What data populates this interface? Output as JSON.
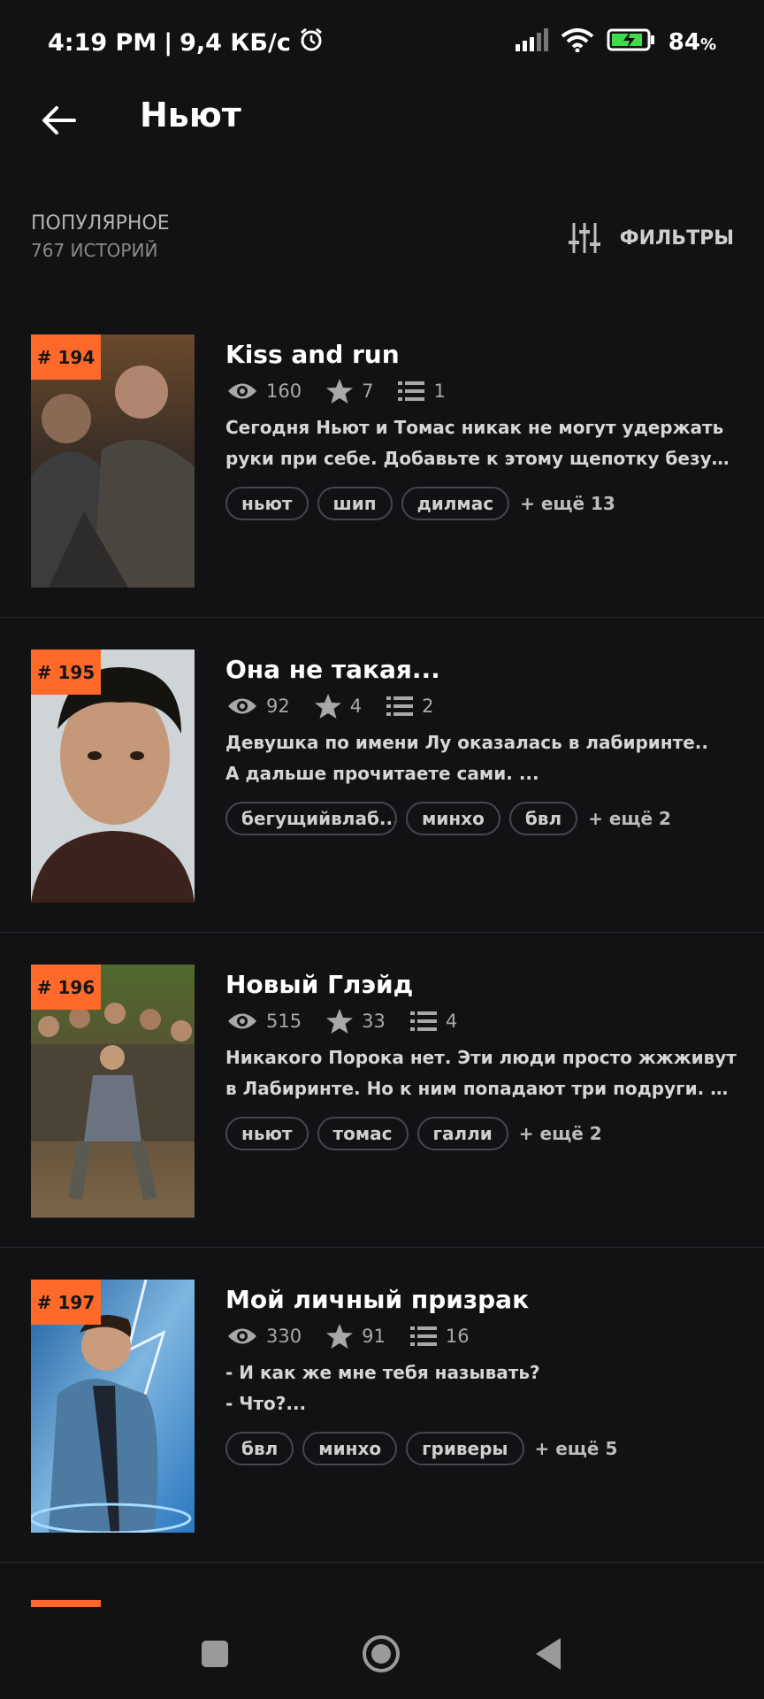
{
  "status_bar": {
    "time": "4:19 PM",
    "speed": "9,4 КБ/с",
    "battery_percent": "84",
    "battery_unit": "%",
    "icons": [
      "alarm-icon",
      "signal-icon",
      "wifi-icon",
      "battery-charging-icon"
    ]
  },
  "app_bar": {
    "back_icon": "arrow-left-icon",
    "title": "Ньют"
  },
  "section": {
    "sort_label": "ПОПУЛЯРНОЕ",
    "count_label": "767 ИСТОРИЙ",
    "filters_label": "ФИЛЬТРЫ",
    "filters_icon": "sliders-icon"
  },
  "stories": [
    {
      "rank": "# 194",
      "title": "Kiss and run",
      "views": "160",
      "stars": "7",
      "chapters": "1",
      "desc_line1": "Сегодня Ньют и Томас никак не могут удержать",
      "desc_line2": "руки при себе. Добавьте к этому щепотку безумия и ...",
      "tags": [
        "ньют",
        "шип",
        "дилмас"
      ],
      "more_tags": "+ ещё 13"
    },
    {
      "rank": "# 195",
      "title": "Она не такая...",
      "views": "92",
      "stars": "4",
      "chapters": "2",
      "desc_line1": "Девушка по имени Лу оказалась в лабиринте..",
      "desc_line2": "А дальше прочитаете сами. ...",
      "tags": [
        "бегущийвлаб...",
        "минхо",
        "бвл"
      ],
      "more_tags": "+ ещё 2"
    },
    {
      "rank": "# 196",
      "title": "Новый Глэйд",
      "views": "515",
      "stars": "33",
      "chapters": "4",
      "desc_line1": "Никакого Порока нет. Эти люди просто жжживут",
      "desc_line2": "в Лабиринте. Но к ним попадают три подруги. Как из...",
      "tags": [
        "ньют",
        "томас",
        "галли"
      ],
      "more_tags": "+ ещё 2"
    },
    {
      "rank": "# 197",
      "title": "Мой личный призрак",
      "views": "330",
      "stars": "91",
      "chapters": "16",
      "desc_line1": "- И как же мне тебя называть?",
      "desc_line2": "- Что?...",
      "tags": [
        "бвл",
        "минхо",
        "гриверы"
      ],
      "more_tags": "+ ещё 5"
    }
  ],
  "nav_bar": {
    "icons": [
      "recents-square-icon",
      "home-circle-icon",
      "back-triangle-icon"
    ]
  },
  "colors": {
    "background": "#121114",
    "accent": "#ff6a2b",
    "tag_border": "#47464b"
  }
}
